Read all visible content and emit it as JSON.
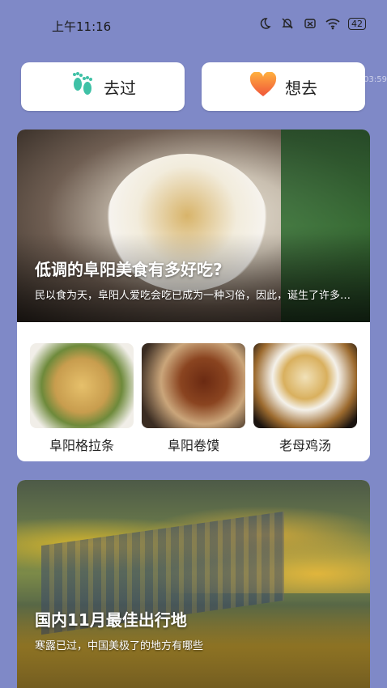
{
  "status_bar": {
    "time": "上午11:16",
    "battery": "42"
  },
  "overlay_time": "03:59",
  "actions": {
    "been_label": "去过",
    "want_label": "想去"
  },
  "featured": {
    "title": "低调的阜阳美食有多好吃?",
    "subtitle": "民以食为天，阜阳人爱吃会吃已成为一种习俗，因此，诞生了许多让人念念不忘的美食。",
    "items": [
      {
        "label": "阜阳格拉条"
      },
      {
        "label": "阜阳卷馍"
      },
      {
        "label": "老母鸡汤"
      }
    ]
  },
  "travel": {
    "title": "国内11月最佳出行地",
    "subtitle": "寒露已过，中国美极了的地方有哪些"
  },
  "colors": {
    "background": "#7f89c7",
    "heart": "#f5893a",
    "footprint": "#3fc1a6"
  }
}
